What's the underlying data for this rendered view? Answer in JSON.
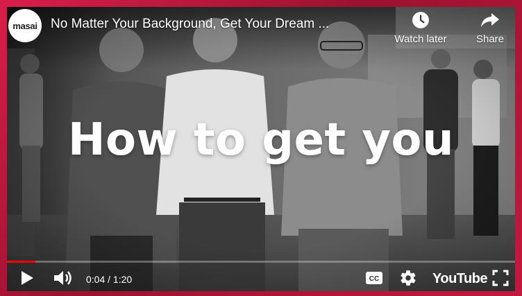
{
  "channel": {
    "logo_text": "masai"
  },
  "video": {
    "title": "No Matter Your Background, Get Your Dream ...",
    "headline": "How to get you"
  },
  "top_actions": {
    "watch_later_label": "Watch later",
    "share_label": "Share"
  },
  "player": {
    "time_display": "0:04 / 1:20",
    "progress_fraction": 0.0555,
    "brand_label": "YouTube"
  },
  "colors": {
    "frame_accent": "#c4183f",
    "progress": "#ff0000"
  }
}
